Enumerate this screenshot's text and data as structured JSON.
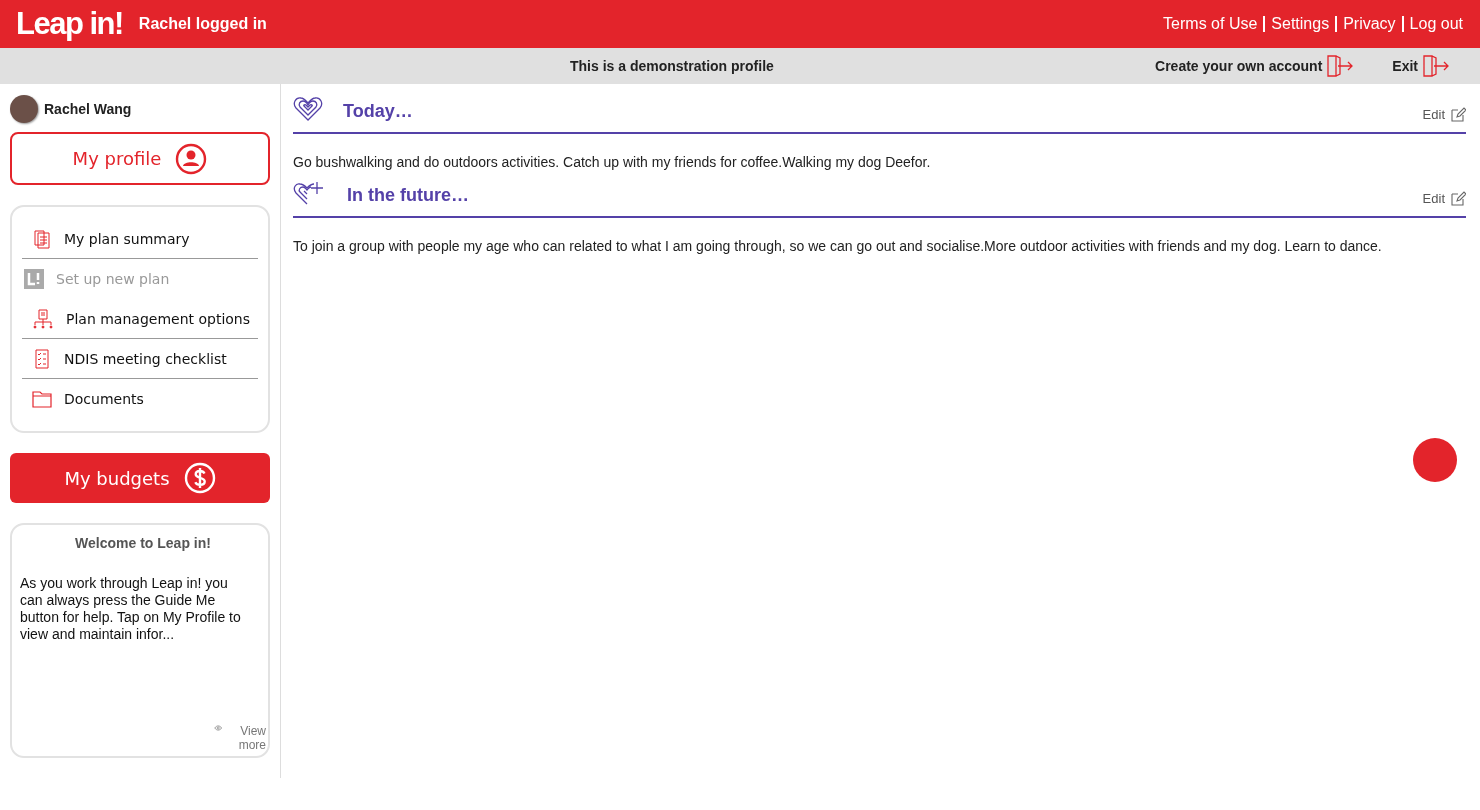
{
  "header": {
    "logo": "Leap in!",
    "user_status": "Rachel logged in",
    "links": [
      "Terms of Use",
      "Settings",
      "Privacy",
      "Log out"
    ]
  },
  "banner": {
    "message": "This is a demonstration profile",
    "actions": [
      {
        "label": "Create your own account"
      },
      {
        "label": "Exit"
      }
    ]
  },
  "sidebar": {
    "user_name": "Rachel Wang",
    "profile_button": "My profile",
    "nav_items": [
      {
        "label": "My plan summary",
        "kind": "summary",
        "disabled": false
      },
      {
        "label": "Set up new plan",
        "kind": "newplan",
        "disabled": true
      },
      {
        "label": "Plan management options",
        "kind": "management",
        "disabled": false
      },
      {
        "label": "NDIS meeting checklist",
        "kind": "checklist",
        "disabled": false
      },
      {
        "label": "Documents",
        "kind": "documents",
        "disabled": false
      }
    ],
    "budgets_button": "My budgets",
    "welcome": {
      "title": "Welcome to Leap in!",
      "body": "As you work through Leap in! you can always press the Guide Me button for help. Tap on My Profile to view and maintain infor...",
      "view_more": "View more"
    }
  },
  "sections": [
    {
      "kind": "today",
      "title": "Today…",
      "edit": "Edit",
      "text": "Go bushwalking and do outdoors activities. Catch up with my friends for coffee.Walking my dog Deefor."
    },
    {
      "kind": "future",
      "title": "In the future…",
      "edit": "Edit",
      "text": "To join a group with people my age who can related to what I am going through, so we can go out and socialise.More outdoor activities with friends and my dog. Learn to dance."
    }
  ]
}
